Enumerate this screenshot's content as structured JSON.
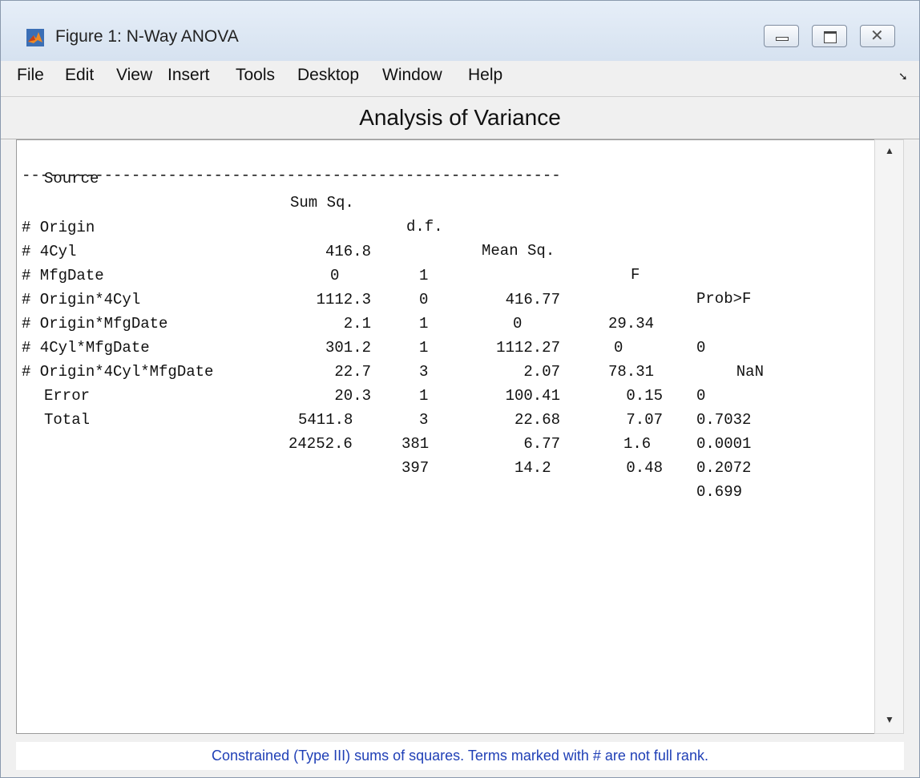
{
  "window": {
    "title": "Figure 1: N-Way ANOVA"
  },
  "menu": [
    "File",
    "Edit",
    "View",
    "Insert",
    "Tools",
    "Desktop",
    "Window",
    "Help"
  ],
  "heading": "Analysis of Variance",
  "table": {
    "headers": [
      "Source",
      "Sum Sq.",
      "d.f.",
      "Mean Sq.",
      "F",
      "Prob>F"
    ],
    "divider": "-----------------------------------------------------------",
    "rows": [
      [
        "# Origin",
        "416.8",
        "1",
        "416.77",
        "29.34",
        "0"
      ],
      [
        "# 4Cyl",
        "0",
        "0",
        "0",
        "0",
        "NaN"
      ],
      [
        "# MfgDate",
        "1112.3",
        "1",
        "1112.27",
        "78.31",
        "0"
      ],
      [
        "# Origin*4Cyl",
        "2.1",
        "1",
        "2.07",
        "0.15",
        "0.7032"
      ],
      [
        "# Origin*MfgDate",
        "301.2",
        "3",
        "100.41",
        "7.07",
        "0.0001"
      ],
      [
        "# 4Cyl*MfgDate",
        "22.7",
        "1",
        "22.68",
        "1.6",
        "0.2072"
      ],
      [
        "# Origin*4Cyl*MfgDate",
        "20.3",
        "3",
        "6.77",
        "0.48",
        "0.699"
      ],
      [
        "Error",
        "5411.8",
        "381",
        "14.2",
        "",
        ""
      ],
      [
        "Total",
        "24252.6",
        "397",
        "",
        "",
        ""
      ]
    ]
  },
  "status_text": "Constrained (Type III) sums of squares.  Terms marked with # are not full rank.",
  "icons": {
    "app": "matlab-icon",
    "minimize": "minimize-icon",
    "maximize": "maximize-icon",
    "close": "close-icon"
  }
}
